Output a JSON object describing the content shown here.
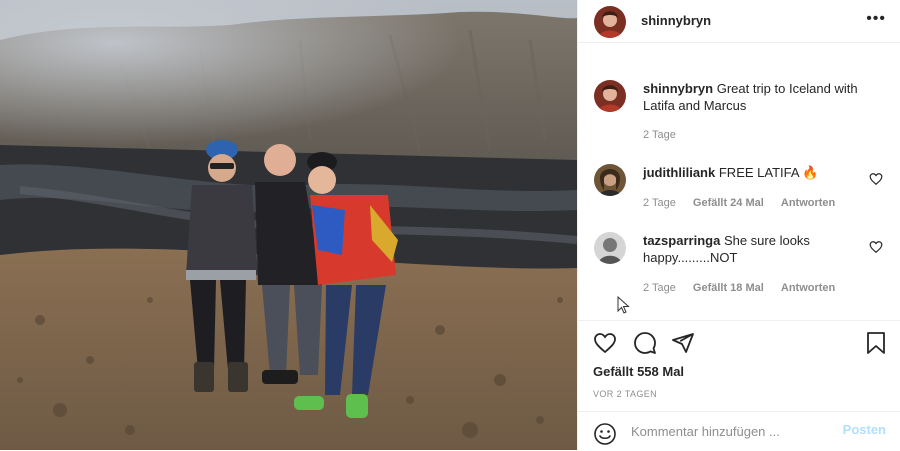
{
  "post": {
    "username": "shinnybryn",
    "more_icon": "more-horizontal-icon"
  },
  "caption": {
    "username": "shinnybryn",
    "text": "Great trip to Iceland with Latifa and Marcus",
    "time": "2 Tage"
  },
  "comments": [
    {
      "username": "judithliliank",
      "text": "FREE LATIFA 🔥",
      "time": "2 Tage",
      "likes": "Gefällt 24 Mal",
      "reply": "Antworten"
    },
    {
      "username": "tazsparringa",
      "text": "She sure looks happy.........NOT",
      "time": "2 Tage",
      "likes": "Gefällt 18 Mal",
      "reply": "Antworten"
    }
  ],
  "actions": {
    "like_count": "Gefällt 558 Mal",
    "posted": "VOR 2 TAGEN"
  },
  "comment_box": {
    "placeholder": "Kommentar hinzufügen ...",
    "post_label": "Posten"
  },
  "colors": {
    "link_disabled": "#b2dffc",
    "meta": "#8e8e8e",
    "text": "#262626"
  }
}
